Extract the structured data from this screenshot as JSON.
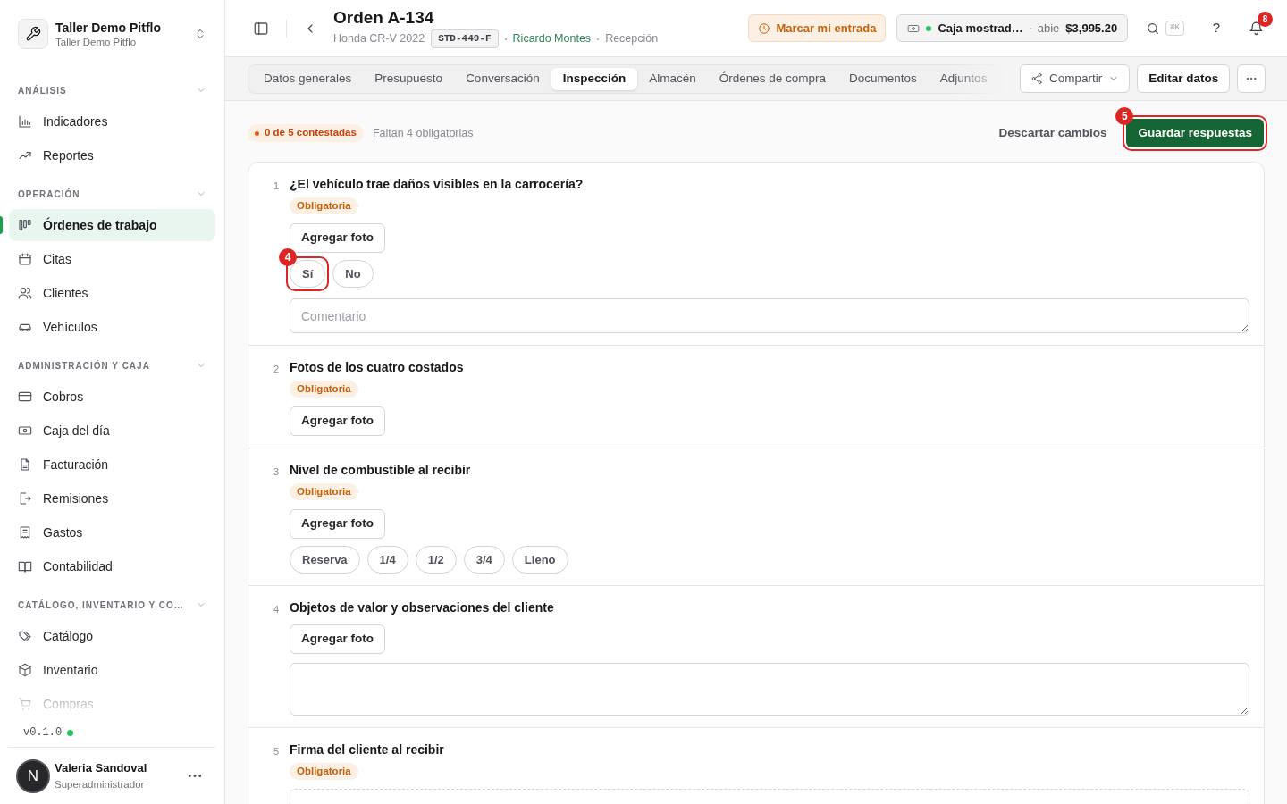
{
  "workspace": {
    "name": "Taller Demo Pitflo",
    "subtitle": "Taller Demo Pitflo"
  },
  "sidebar": {
    "sections": [
      {
        "label": "ANÁLISIS",
        "expanded": true,
        "items": [
          {
            "label": "Indicadores",
            "selected": false
          },
          {
            "label": "Reportes",
            "selected": false
          }
        ]
      },
      {
        "label": "OPERACIÓN",
        "expanded": true,
        "items": [
          {
            "label": "Órdenes de trabajo",
            "selected": true
          },
          {
            "label": "Citas",
            "selected": false
          },
          {
            "label": "Clientes",
            "selected": false
          },
          {
            "label": "Vehículos",
            "selected": false
          }
        ]
      },
      {
        "label": "ADMINISTRACIÓN Y CAJA",
        "expanded": true,
        "items": [
          {
            "label": "Cobros",
            "selected": false
          },
          {
            "label": "Caja del día",
            "selected": false
          },
          {
            "label": "Facturación",
            "selected": false
          },
          {
            "label": "Remisiones",
            "selected": false
          },
          {
            "label": "Gastos",
            "selected": false
          },
          {
            "label": "Contabilidad",
            "selected": false
          }
        ]
      },
      {
        "label": "CATÁLOGO, INVENTARIO Y CO…",
        "expanded": true,
        "items": [
          {
            "label": "Catálogo",
            "selected": false
          },
          {
            "label": "Inventario",
            "selected": false
          },
          {
            "label": "Compras",
            "selected": false
          }
        ]
      }
    ],
    "version": "v0.1.0",
    "user": {
      "initial": "N",
      "name": "Valeria Sandoval",
      "role": "Superadministrador"
    }
  },
  "header": {
    "title": "Orden A-134",
    "vehicle": "Honda CR-V 2022",
    "plate": "STD-449-F",
    "advisor": "Ricardo Montes",
    "stage": "Recepción",
    "clock_in": "Marcar mi entrada",
    "register": {
      "name": "Caja mostrad…",
      "status": "abie",
      "amount": "$3,995.20"
    },
    "shortcut": "⌘K",
    "help": "?",
    "notifications": "8"
  },
  "tabs": [
    {
      "label": "Datos generales",
      "selected": false
    },
    {
      "label": "Presupuesto",
      "selected": false
    },
    {
      "label": "Conversación",
      "selected": false
    },
    {
      "label": "Inspección",
      "selected": true
    },
    {
      "label": "Almacén",
      "selected": false
    },
    {
      "label": "Órdenes de compra",
      "selected": false
    },
    {
      "label": "Documentos",
      "selected": false
    },
    {
      "label": "Adjuntos",
      "selected": false
    }
  ],
  "actions": {
    "share": "Compartir",
    "edit": "Editar datos"
  },
  "progress": {
    "answered": "0 de 5 contestadas",
    "missing": "Faltan 4 obligatorias",
    "discard": "Descartar cambios",
    "save": "Guardar respuestas",
    "save_callout": "5"
  },
  "questions": [
    {
      "number": "1",
      "title": "¿El vehículo trae daños visibles en la carrocería?",
      "badge": "Obligatoria",
      "photo": "Agregar foto",
      "kind": "yes_no",
      "options": [
        {
          "label": "Sí",
          "selected": false,
          "callout": "4"
        },
        {
          "label": "No",
          "selected": false
        }
      ],
      "placeholder": "Comentario"
    },
    {
      "number": "2",
      "title": "Fotos de los cuatro costados",
      "badge": "Obligatoria",
      "photo": "Agregar foto",
      "kind": "photo"
    },
    {
      "number": "3",
      "title": "Nivel de combustible al recibir",
      "badge": "Obligatoria",
      "photo": "Agregar foto",
      "kind": "choice",
      "options": [
        {
          "label": "Reserva",
          "selected": false
        },
        {
          "label": "1/4",
          "selected": false
        },
        {
          "label": "1/2",
          "selected": false
        },
        {
          "label": "3/4",
          "selected": false
        },
        {
          "label": "Lleno",
          "selected": false
        }
      ]
    },
    {
      "number": "4",
      "title": "Objetos de valor y observaciones del cliente",
      "photo": "Agregar foto",
      "kind": "text"
    },
    {
      "number": "5",
      "title": "Firma del cliente al recibir",
      "badge": "Obligatoria",
      "kind": "signature"
    }
  ]
}
